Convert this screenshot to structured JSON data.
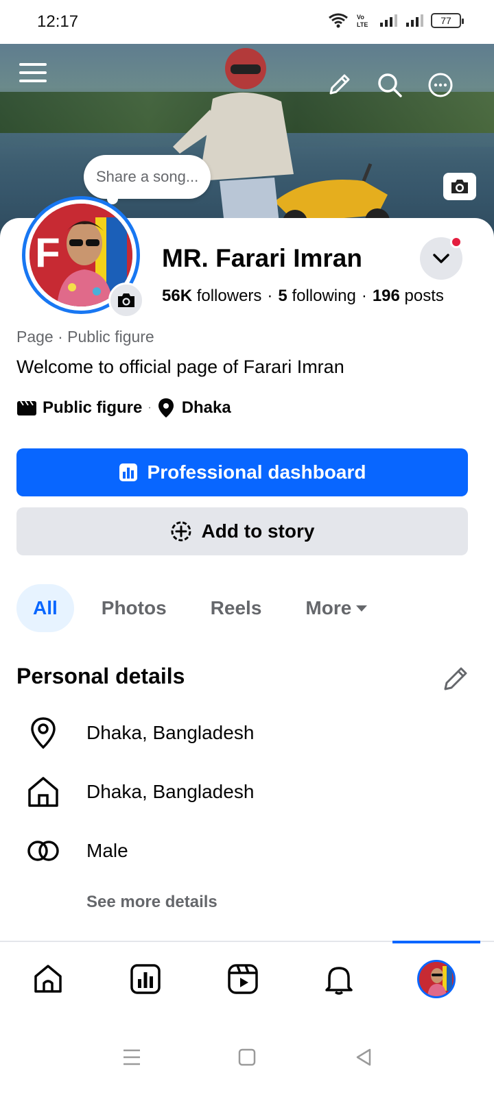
{
  "status_bar": {
    "time": "12:17",
    "battery": "77",
    "network_label": "Vo LTE"
  },
  "cover": {
    "song_prompt": "Share a song..."
  },
  "profile": {
    "name": "MR. Farari Imran",
    "followers_count": "56K",
    "followers_label": "followers",
    "following_count": "5",
    "following_label": "following",
    "posts_count": "196",
    "posts_label": "posts",
    "category_line": "Page · Public figure",
    "bio": "Welcome to official page of Farari Imran",
    "meta": {
      "category": "Public figure",
      "location": "Dhaka"
    }
  },
  "actions": {
    "dashboard_label": "Professional dashboard",
    "story_label": "Add to story"
  },
  "tabs": [
    {
      "label": "All",
      "active": true
    },
    {
      "label": "Photos",
      "active": false
    },
    {
      "label": "Reels",
      "active": false
    },
    {
      "label": "More",
      "active": false
    }
  ],
  "personal_details": {
    "title": "Personal details",
    "items": [
      {
        "icon": "location-pin-icon",
        "text": "Dhaka, Bangladesh"
      },
      {
        "icon": "home-icon",
        "text": "Dhaka, Bangladesh"
      },
      {
        "icon": "gender-icon",
        "text": "Male"
      }
    ],
    "see_more": "See more details"
  },
  "bottom_nav": [
    "home-icon",
    "dashboard-icon",
    "reels-icon",
    "notifications-icon",
    "profile-avatar"
  ],
  "colors": {
    "primary": "#0866ff",
    "secondary_button": "#e4e6eb",
    "text": "#050505",
    "muted_text": "#65676b",
    "active_tab_bg": "#e7f3ff",
    "notification_dot": "#e41e3f"
  }
}
